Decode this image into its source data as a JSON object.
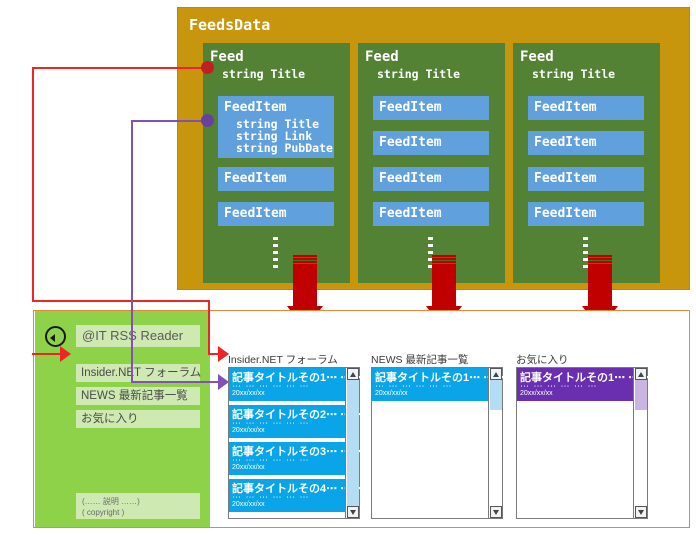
{
  "diagram": {
    "feeds_data": {
      "label": "FeedsData",
      "feeds": [
        {
          "name": "Feed",
          "field": "string Title",
          "items": [
            {
              "name": "FeedItem",
              "fields": [
                "string Title",
                "string Link",
                "string PubDate"
              ]
            },
            {
              "name": "FeedItem",
              "fields": []
            },
            {
              "name": "FeedItem",
              "fields": []
            }
          ],
          "ellipsis": "⋮"
        },
        {
          "name": "Feed",
          "field": "string Title",
          "items": [
            {
              "name": "FeedItem",
              "fields": []
            },
            {
              "name": "FeedItem",
              "fields": []
            },
            {
              "name": "FeedItem",
              "fields": []
            },
            {
              "name": "FeedItem",
              "fields": []
            }
          ],
          "ellipsis": "⋮"
        },
        {
          "name": "Feed",
          "field": "string Title",
          "items": [
            {
              "name": "FeedItem",
              "fields": []
            },
            {
              "name": "FeedItem",
              "fields": []
            },
            {
              "name": "FeedItem",
              "fields": []
            },
            {
              "name": "FeedItem",
              "fields": []
            }
          ],
          "ellipsis": "⋮"
        }
      ]
    },
    "colors": {
      "feeds_data_bg": "#c8960c",
      "feed_bg": "#538234",
      "feed_item_bg": "#60a0dd",
      "sidebar_bg": "#8ed24a",
      "app_frame_border": "#e8873a",
      "arrow_red": "#c00000",
      "connector_red": "#ef2525",
      "connector_purple": "#8150b8",
      "list_selected_blue": "#0aa4e8",
      "list_selected_purple": "#6a2fb0"
    }
  },
  "app": {
    "sidebar": {
      "back_button_icon": "back-arrow-icon",
      "title": "@IT RSS Reader",
      "nav_items": [
        {
          "label": "Insider.NET フォーラム"
        },
        {
          "label": "NEWS 最新記事一覧"
        },
        {
          "label": "お気に入り"
        }
      ],
      "footer": {
        "line1": "(…… 説明 ……)",
        "line2": "( copyright )"
      }
    },
    "panels": [
      {
        "title": "Insider.NET フォーラム",
        "accent": "#0aa4e8",
        "rows": [
          {
            "title": "記事タイトルその1⋯ ⋯ ⋯",
            "summary": "⋯ ⋯  ⋯ ⋯  ⋯ ⋯",
            "date": "20xx/xx/xx",
            "selected": true
          },
          {
            "title": "記事タイトルその2⋯ ⋯ ⋯",
            "summary": "⋯ ⋯  ⋯ ⋯  ⋯ ⋯",
            "date": "20xx/xx/xx",
            "selected": true
          },
          {
            "title": "記事タイトルその3⋯ ⋯ ⋯",
            "summary": "⋯ ⋯  ⋯ ⋯  ⋯ ⋯",
            "date": "20xx/xx/xx",
            "selected": true
          },
          {
            "title": "記事タイトルその4⋯ ⋯ ⋯",
            "summary": "⋯ ⋯  ⋯ ⋯  ⋯ ⋯",
            "date": "20xx/xx/xx",
            "selected": true
          }
        ]
      },
      {
        "title": "NEWS 最新記事一覧",
        "accent": "#0aa4e8",
        "rows": [
          {
            "title": "記事タイトルその1⋯ ⋯ ⋯",
            "summary": "⋯ ⋯  ⋯ ⋯  ⋯ ⋯",
            "date": "20xx/xx/xx",
            "selected": true
          }
        ]
      },
      {
        "title": "お気に入り",
        "accent": "#6a2fb0",
        "rows": [
          {
            "title": "記事タイトルその1⋯ ⋯ ⋯",
            "summary": "⋯ ⋯  ⋯ ⋯  ⋯ ⋯",
            "date": "20xx/xx/xx",
            "selected": true
          }
        ]
      }
    ]
  }
}
